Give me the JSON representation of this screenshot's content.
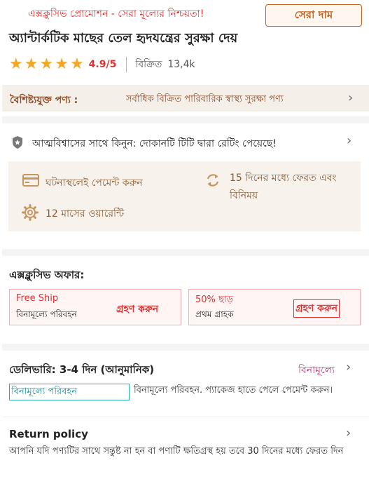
{
  "promo": {
    "text": "এক্সক্লুসিভ প্রোমোশন - সেরা মূল্যের নিশ্চয়তা!",
    "best_price_label": "সেরা দাম"
  },
  "product": {
    "title": "অ্যান্টার্কটিক মাছের তেল হৃদযন্ত্রের সুরক্ষা দেয়",
    "rating_score": "4.9/5",
    "rating_stars": 5,
    "sold_label": "বিক্রিত",
    "sold_count": "13,4k"
  },
  "featured": {
    "label": "বৈশিষ্ট্যযুক্ত পণ্য :",
    "text": "সর্বাধিক বিক্রিত পারিবারিক স্বাস্থ্য সুরক্ষা পণ্য"
  },
  "trust": {
    "text": "আত্মবিশ্বাসের সাথে কিনুন: দোকানটি টিটি দ্বারা রেটিং পেয়েছে!"
  },
  "services": {
    "cod": "ঘটনাস্থলেই পেমেন্ট করুন",
    "return_line1": "15 দিনের মধ্যে ফেরত এবং",
    "return_line2": "বিনিময়",
    "warranty": "12 মাসের ওয়ারেন্টি"
  },
  "offers": {
    "title": "এক্সক্লুসিভ অফার:",
    "coupons": [
      {
        "title": "Free Ship",
        "subtitle": "বিনামূল্যে পরিবহন",
        "button": "গ্রহণ করুন"
      },
      {
        "title": "50% ছাড়",
        "subtitle": "প্রথম গ্রাহক",
        "button": "গ্রহণ করুন"
      }
    ]
  },
  "delivery": {
    "title": "ডেলিভারি: 3-4 দিন (আনুমানিক)",
    "free_label": "বিনামূল্যে",
    "chip": "বিনামূল্যে পরিবহন",
    "description": "বিনামূল্যে পরিবহন. প্যাকেজ হাতে পেলে পেমেন্ট করুন।"
  },
  "return_policy": {
    "title": "Return policy",
    "text": "আপনি যদি পণ্যটির সাথে সন্তুষ্ট না হন বা পণ্যটি ক্ষতিগ্রস্থ হয় তবে 30 দিনের মধ্যে ফেরত দিন"
  },
  "colors": {
    "accent_red": "#e0302f",
    "brown": "#8a4a26",
    "star": "#f5a623",
    "teal": "#1a8f9a",
    "magenta": "#c03a7f"
  }
}
